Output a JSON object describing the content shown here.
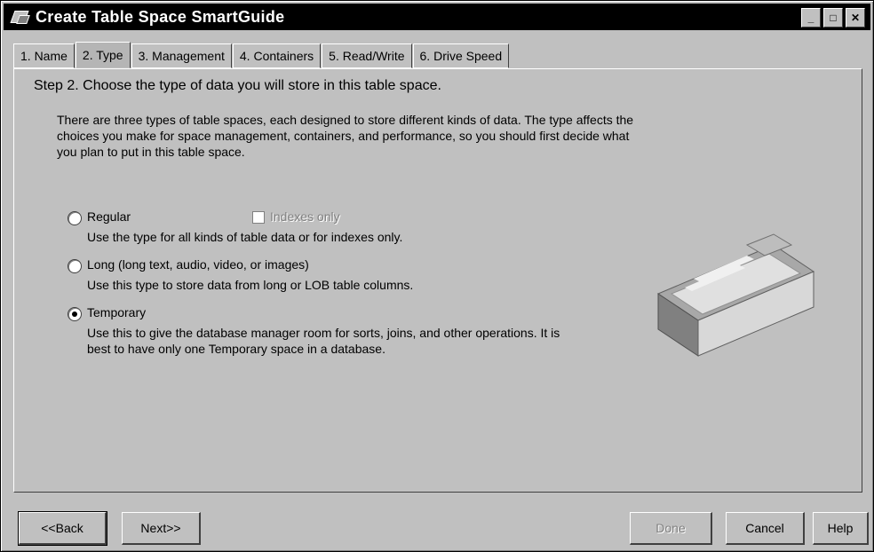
{
  "window": {
    "title": "Create Table Space SmartGuide",
    "controls": {
      "minimize_icon": "_",
      "maximize_icon": "□",
      "close_icon": "✕"
    }
  },
  "tabs": [
    {
      "label": "1. Name"
    },
    {
      "label": "2. Type",
      "active": true
    },
    {
      "label": "3. Management"
    },
    {
      "label": "4. Containers"
    },
    {
      "label": "5. Read/Write"
    },
    {
      "label": "6. Drive Speed"
    }
  ],
  "step": {
    "title": "Step 2. Choose the type of data you will store in this table space.",
    "intro": "There are three types of table spaces, each designed to store different kinds of data. The type affects the choices you make for space management, containers, and performance, so you should first decide what you plan to put in this table space."
  },
  "options": {
    "regular": {
      "label": "Regular",
      "description": "Use the type for all kinds of table data or for indexes only.",
      "checked": false
    },
    "indexes_only": {
      "label": "Indexes only",
      "enabled": false,
      "checked": false
    },
    "long": {
      "label": "Long (long text, audio, video, or images)",
      "description": "Use this type to store data from long or LOB table columns.",
      "checked": false
    },
    "temporary": {
      "label": "Temporary",
      "description": "Use this to give the database manager room for sorts, joins, and other operations. It is best to have only one Temporary space in a database.",
      "checked": true
    }
  },
  "buttons": {
    "back": "<<Back",
    "next": "Next>>",
    "done": "Done",
    "cancel": "Cancel",
    "help": "Help"
  }
}
